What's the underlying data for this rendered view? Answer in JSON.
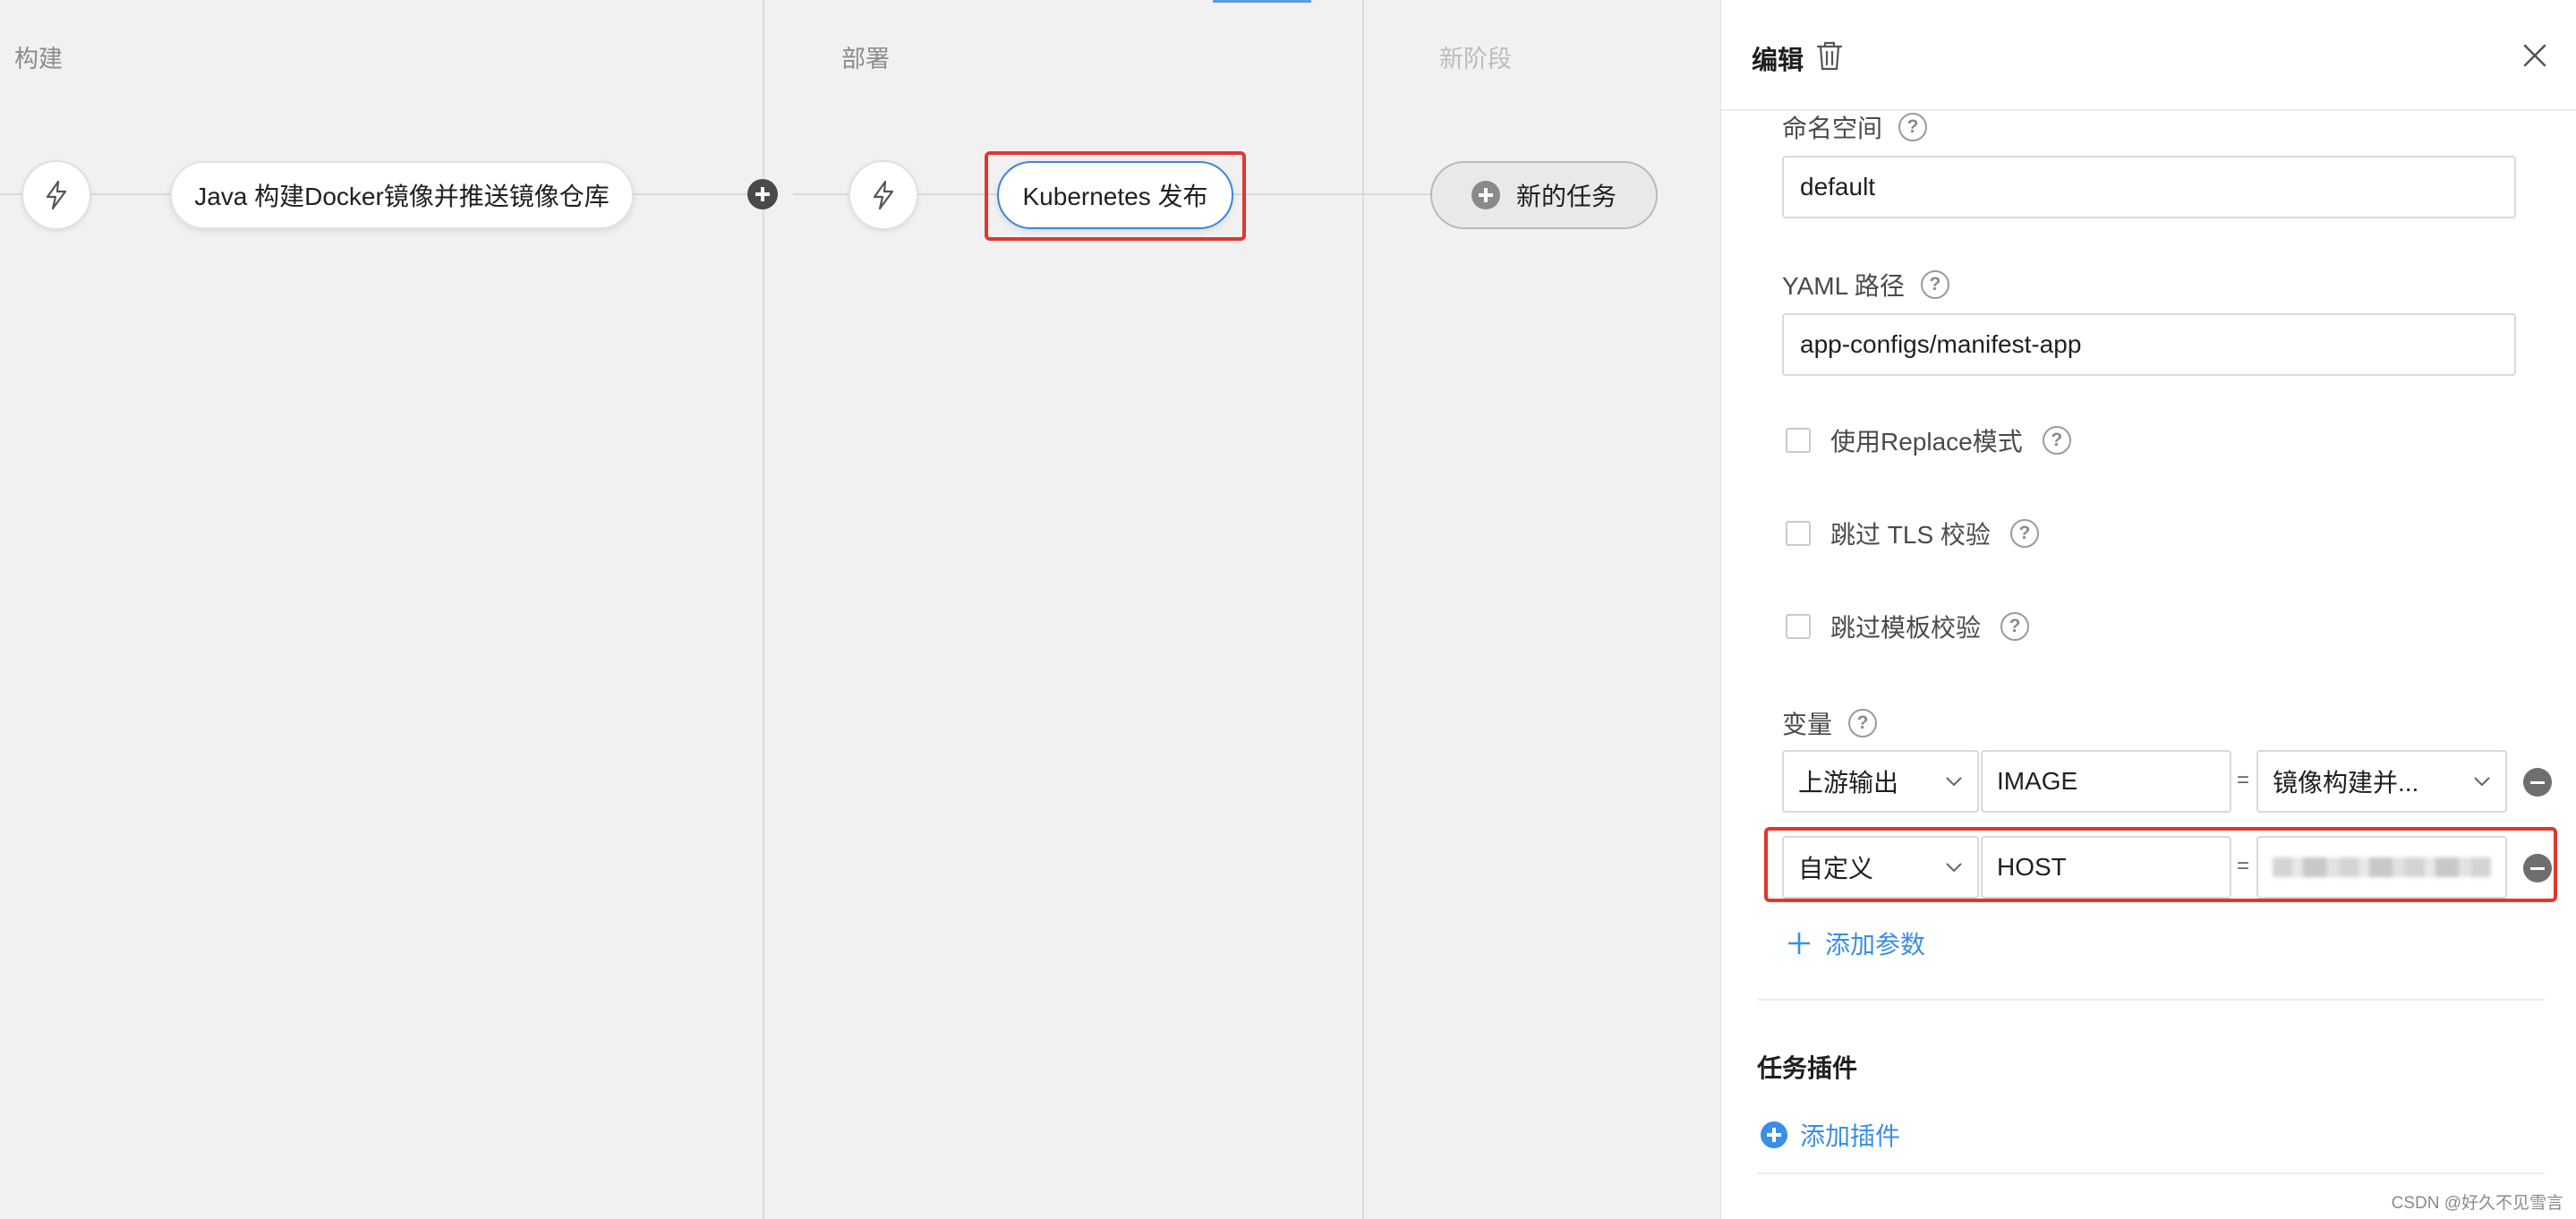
{
  "pipeline": {
    "stages": [
      {
        "title": "构建",
        "dim": false
      },
      {
        "title": "部署",
        "dim": false
      },
      {
        "title": "新阶段",
        "dim": true
      }
    ],
    "build_task": "Java 构建Docker镜像并推送镜像仓库",
    "deploy_task": "Kubernetes 发布",
    "new_task": "新的任务",
    "icons": {
      "trigger": "lightning-icon",
      "add": "plus-circle-icon"
    }
  },
  "panel": {
    "title": "编辑",
    "namespace": {
      "label": "命名空间",
      "value": "default"
    },
    "yaml_path": {
      "label": "YAML 路径",
      "value": "app-configs/manifest-app"
    },
    "checkboxes": [
      {
        "label": "使用Replace模式",
        "checked": false
      },
      {
        "label": "跳过 TLS 校验",
        "checked": false
      },
      {
        "label": "跳过模板校验",
        "checked": false
      }
    ],
    "variables": {
      "label": "变量",
      "rows": [
        {
          "type": "上游输出",
          "name": "IMAGE",
          "eq": "=",
          "value": "镜像构建并..."
        },
        {
          "type": "自定义",
          "name": "HOST",
          "eq": "=",
          "value": ""
        }
      ],
      "add_param": "添加参数"
    },
    "plugins": {
      "title": "任务插件",
      "add_plugin": "添加插件"
    },
    "colors": {
      "accent": "#3a8ee6",
      "highlight": "#e0372e",
      "selected_border": "#3b86d6"
    }
  },
  "watermark": "CSDN @好久不见雪言"
}
